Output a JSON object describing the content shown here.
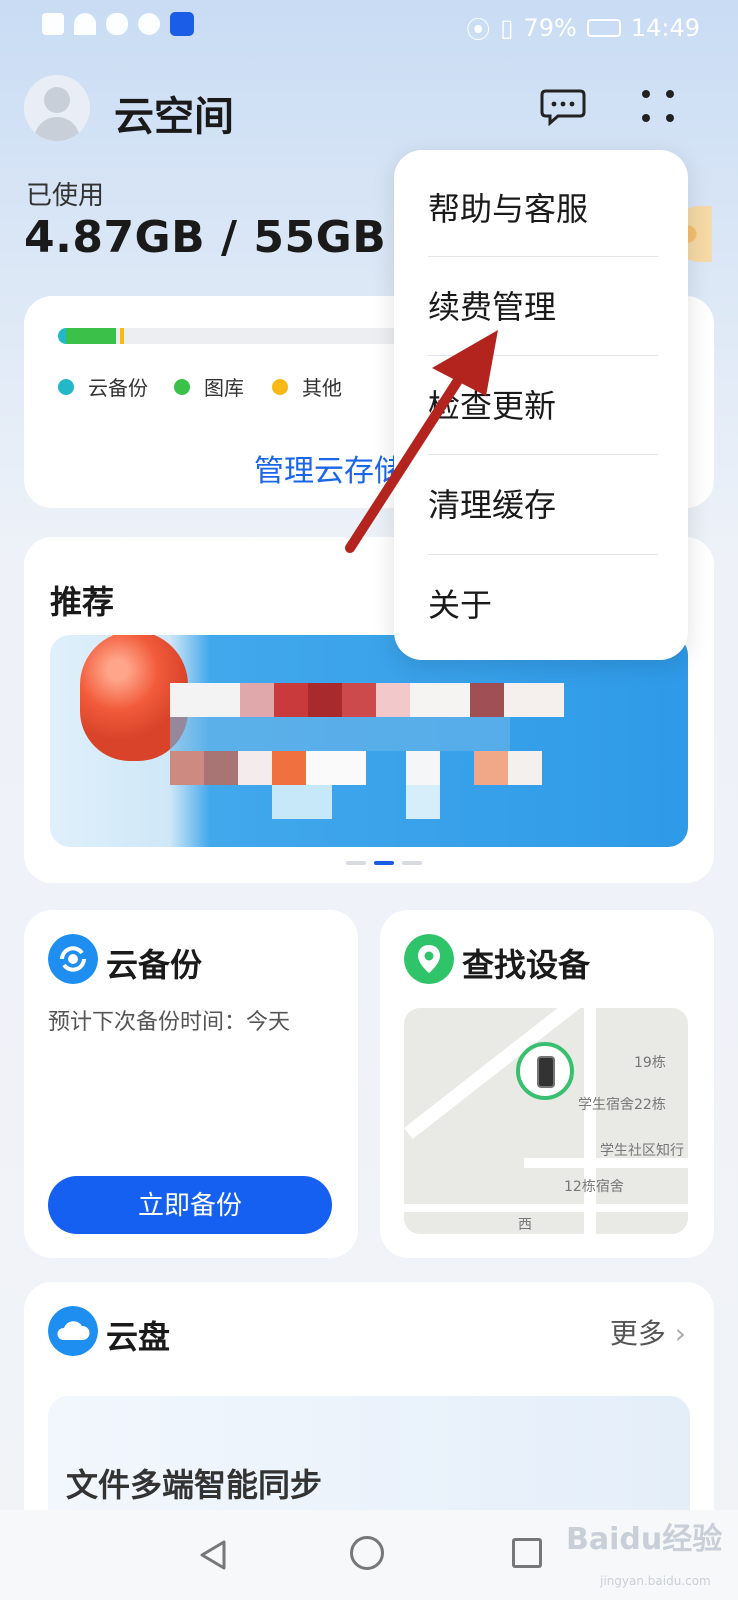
{
  "status_bar": {
    "battery": "79%",
    "time": "14:49"
  },
  "header": {
    "title": "云空间",
    "icons": [
      "message-icon",
      "more-dots-icon"
    ]
  },
  "storage": {
    "used_label": "已使用",
    "used_value": "4.87GB / 55GB",
    "legend": [
      "云备份",
      "图库",
      "其他"
    ],
    "manage_link": "管理云存储",
    "colors": {
      "backup": "#21b8c8",
      "gallery": "#3bc14a",
      "other": "#f6b918"
    }
  },
  "recommend": {
    "title": "推荐"
  },
  "backup": {
    "title": "云备份",
    "subtitle": "预计下次备份时间：今天",
    "button": "立即备份"
  },
  "find_device": {
    "title": "查找设备",
    "map_labels": [
      "19栋",
      "学生宿舍22栋",
      "学生社区知行",
      "12栋宿舍",
      "西"
    ]
  },
  "cloud_disk": {
    "title": "云盘",
    "more": "更多",
    "promo_text": "文件多端智能同步"
  },
  "menu": {
    "items": [
      "帮助与客服",
      "续费管理",
      "检查更新",
      "清理缓存",
      "关于"
    ]
  },
  "watermark": {
    "text": "Baidu经验",
    "sub": "jingyan.baidu.com"
  }
}
